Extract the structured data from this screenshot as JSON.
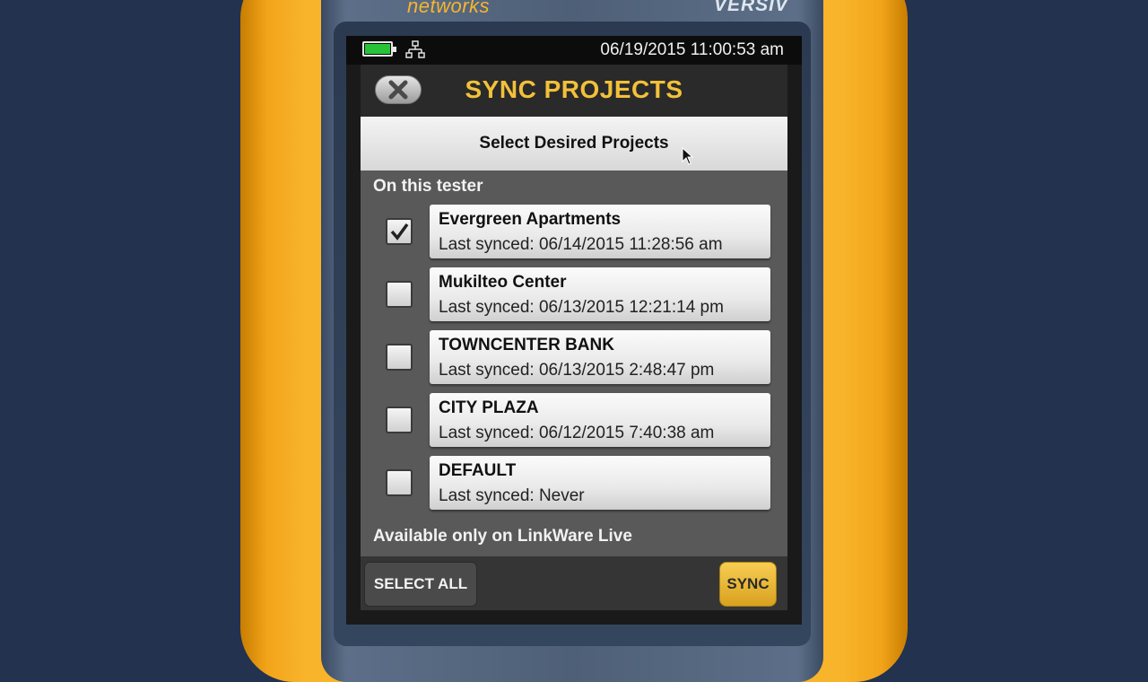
{
  "device": {
    "brand": "networks",
    "model": "VERSIV"
  },
  "status_bar": {
    "datetime": "06/19/2015 11:00:53 am",
    "battery_icon": "battery-full-icon",
    "network_icon": "network-icon"
  },
  "header": {
    "title": "SYNC PROJECTS",
    "close_icon": "close-icon"
  },
  "subtitle": "Select Desired Projects",
  "sections": {
    "on_tester": "On this tester",
    "linkware_only": "Available only on LinkWare Live"
  },
  "projects": [
    {
      "name": "Evergreen Apartments",
      "last_synced": "Last synced: 06/14/2015 11:28:56 am",
      "checked": true
    },
    {
      "name": "Mukilteo Center",
      "last_synced": "Last synced: 06/13/2015 12:21:14 pm",
      "checked": false
    },
    {
      "name": "TOWNCENTER BANK",
      "last_synced": "Last synced: 06/13/2015 2:48:47 pm",
      "checked": false
    },
    {
      "name": "CITY PLAZA",
      "last_synced": "Last synced: 06/12/2015 7:40:38 am",
      "checked": false
    },
    {
      "name": "DEFAULT",
      "last_synced": "Last synced: Never",
      "checked": false
    }
  ],
  "footer": {
    "select_all": "SELECT ALL",
    "sync": "SYNC"
  },
  "colors": {
    "accent": "#f2c13a",
    "device_body": "#f6ad1f",
    "battery": "#27c338"
  }
}
